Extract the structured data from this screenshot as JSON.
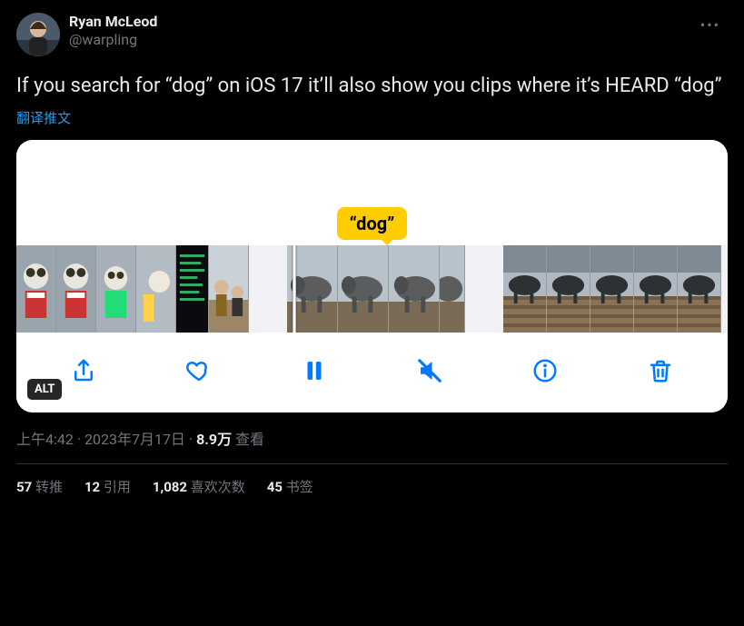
{
  "user": {
    "display_name": "Ryan McLeod",
    "handle": "@warpling"
  },
  "body_text": "If you search for “dog” on iOS 17 it’ll also show you clips where it’s HEARD “dog”",
  "translate_label": "翻译推文",
  "media": {
    "bubble_text": "“dog”",
    "alt_badge": "ALT"
  },
  "meta": {
    "time": "上午4:42",
    "sep1": " · ",
    "date": "2023年7月17日",
    "sep2": " · ",
    "views_count": "8.9万",
    "views_label": " 查看"
  },
  "stats": {
    "retweets_count": "57",
    "retweets_label": " 转推",
    "quotes_count": "12",
    "quotes_label": " 引用",
    "likes_count": "1,082",
    "likes_label": " 喜欢次数",
    "bookmarks_count": "45",
    "bookmarks_label": " 书签"
  }
}
